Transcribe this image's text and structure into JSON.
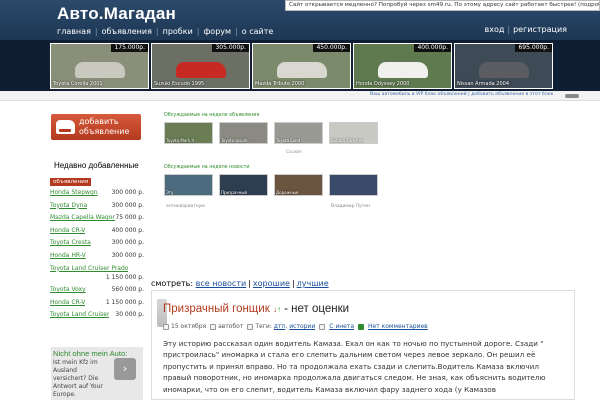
{
  "site": {
    "logo": "Авто.Магадан",
    "notice": "Сайт открывается медленно? Попробуй через sm49.ru. По этому адресу сайт работает быстрее! (подробнее)."
  },
  "nav": {
    "items": [
      "главная",
      "объявления",
      "пробки",
      "форум",
      "о сайте"
    ],
    "login": "вход",
    "register": "регистрация"
  },
  "cars_strip": [
    {
      "price": "175.000р.",
      "caption": "Toyota Corolla 2001",
      "color": "#8a8f7a",
      "car": "#c9c9bf"
    },
    {
      "price": "305.000р.",
      "caption": "Suzuki Escudo 1995",
      "color": "#6b6f64",
      "car": "#c72a22"
    },
    {
      "price": "450.000р.",
      "caption": "Mazda Tribute 2000",
      "color": "#7b8a6b",
      "car": "#d8d8d0"
    },
    {
      "price": "400.000р.",
      "caption": "Honda Odyssey 2000",
      "color": "#5e7a4e",
      "car": "#f0f0ee"
    },
    {
      "price": "695.000р.",
      "caption": "Nissan Armada 2004",
      "color": "#3e4a56",
      "car": "#5a5c62"
    }
  ],
  "vip_bar": {
    "text": "Ваш автомобиль в VIP блок объявлений | добавить объявление в этот блок"
  },
  "add_button": {
    "line1": "добавить",
    "line2": "объявление"
  },
  "recent": {
    "title": "Недавно добавленные",
    "tag": "объявления",
    "items": [
      {
        "name": "Honda Stepwgn",
        "price": "300 000 р."
      },
      {
        "name": "Toyota Dyna",
        "price": "300 000 р."
      },
      {
        "name": "Mazda Capella Wagon",
        "price": "75 000 р."
      },
      {
        "name": "Honda CR-V",
        "price": "400 000 р."
      },
      {
        "name": "Toyota Cresta",
        "price": "300 000 р."
      },
      {
        "name": "Honda HR-V",
        "price": "300 000 р."
      },
      {
        "name": "Toyota Land Cruiser Prado",
        "price": ""
      },
      {
        "name": "",
        "price": "1 150 000 р."
      },
      {
        "name": "Toyota Voxy",
        "price": "560 000 р."
      },
      {
        "name": "Honda CR-V",
        "price": "1 150 000 р."
      },
      {
        "name": "Toyota Land Cruiser",
        "price": "30 000 р."
      }
    ]
  },
  "ad": {
    "title": "Nicht ohne mein Auto:",
    "text": "Ist mein Kfz im Ausland versichert? Die Antwort auf Your Europe.",
    "go": "›"
  },
  "discussed_ads": {
    "title": "Обсуждаемые на неделе объявления",
    "thumbs": [
      {
        "caption": "Toyota Mark II",
        "color": "#6a7d55",
        "label": ""
      },
      {
        "caption": "Toyota Ipsum",
        "color": "#8b8a82",
        "label": ""
      },
      {
        "caption": "Toyota Land",
        "color": "#9a9a94",
        "label": "Cruiser"
      },
      {
        "caption": "Subaru Forester",
        "color": "#c9c9c4",
        "label": ""
      }
    ]
  },
  "discussed_news": {
    "title": "Обсуждаемые на неделе новости",
    "thumbs": [
      {
        "caption": "Эту",
        "color": "#4d6b7e",
        "label": "антиквариатную"
      },
      {
        "caption": "Призрачный",
        "color": "#2c3e50",
        "label": ""
      },
      {
        "caption": "Дорожные",
        "color": "#6b5440",
        "label": ""
      },
      {
        "caption": "",
        "color": "#3a4a6b",
        "label": "Владимир Путин"
      }
    ]
  },
  "sort": {
    "prefix": "смотреть:",
    "all": "все новости",
    "good": "хорошие",
    "best": "лучшие"
  },
  "post": {
    "title_name": "Призрачный гонщик",
    "title_rest": "- нет оценки",
    "date": "15 октября",
    "author": "автобот",
    "tags_label": "Теги:",
    "tags": [
      "дтп",
      "истории"
    ],
    "comment_label": "С инета",
    "comments": "Нет комментариев",
    "body": "Эту историю рассказал один водитель Камаза. Ехал он как то ночью по пустынной дороге. Сзади \" пристроилась\" иномарка и стала его слепить дальним светом через левое зеркало. Он решил её пропустить и принял вправо. Но та продолжала ехать сзади и слепить.Водитель Камаза включил правый поворотник, но иномарка продолжала двигаться следом. Не зная, как объяснить водителю иномарки, что он его слепит, водитель Камаза включил фару заднего хода (у Камазов"
  }
}
